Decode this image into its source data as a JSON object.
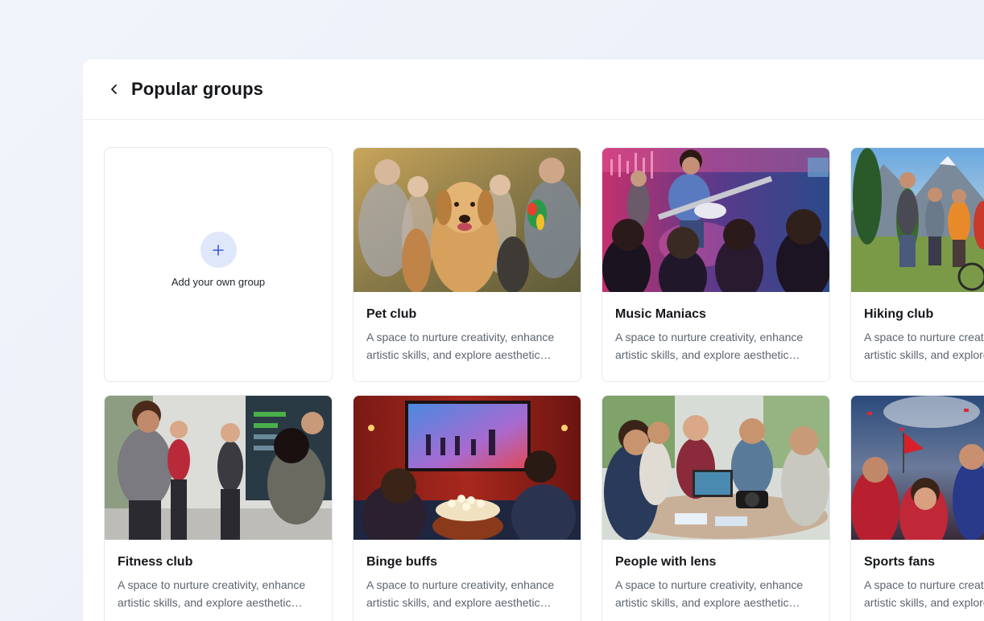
{
  "header": {
    "title": "Popular groups",
    "back_icon": "chevron-left-icon"
  },
  "add_group": {
    "label": "Add your own group",
    "icon": "plus-icon"
  },
  "colors": {
    "accent": "#3a5bd9",
    "plus_bg": "#dfe7fb",
    "text_primary": "#15171a",
    "text_secondary": "#5d6470",
    "border": "#e6e8ec"
  },
  "groups": [
    {
      "title": "Pet club",
      "description": "A space to nurture creativity, enhance artistic skills, and explore aesthetic expression together."
    },
    {
      "title": "Music Maniacs",
      "description": "A space to nurture creativity, enhance artistic skills, and explore aesthetic expression together."
    },
    {
      "title": "Hiking club",
      "description": "A space to nurture creativity, enhance artistic skills, and explore aesthetic expression together."
    },
    {
      "title": "Fitness club",
      "description": "A space to nurture creativity, enhance artistic skills, and explore aesthetic expression together."
    },
    {
      "title": "Binge buffs",
      "description": "A space to nurture creativity, enhance artistic skills, and explore aesthetic expression together."
    },
    {
      "title": "People with lens",
      "description": "A space to nurture creativity, enhance artistic skills, and explore aesthetic expression together."
    },
    {
      "title": "Sports fans",
      "description": "A space to nurture creativity, enhance artistic skills, and explore aesthetic expression together."
    }
  ]
}
